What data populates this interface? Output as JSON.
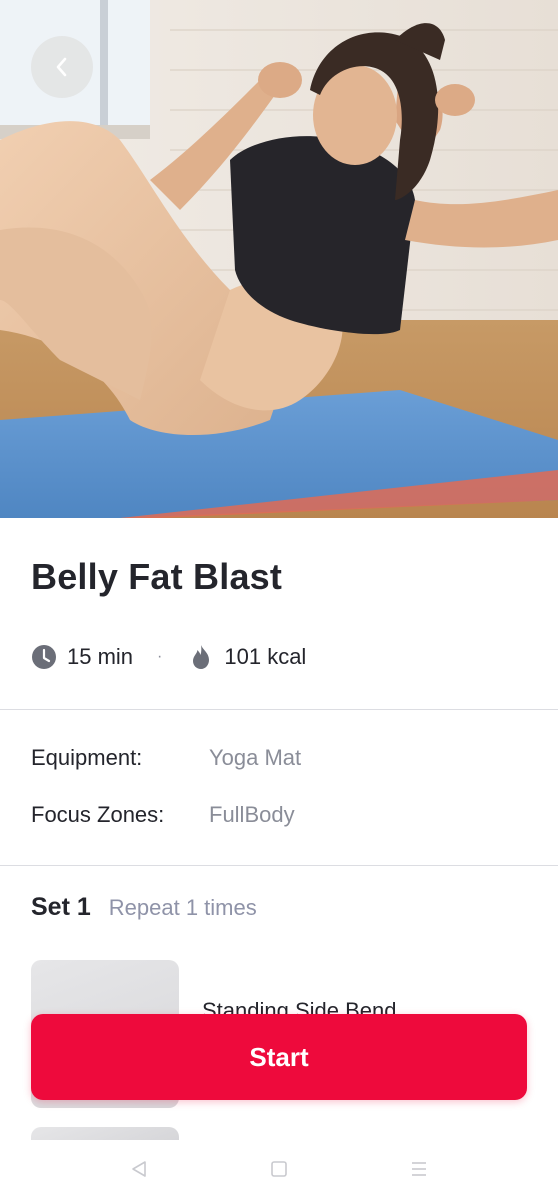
{
  "workout": {
    "title": "Belly Fat Blast",
    "duration": "15 min",
    "separator": "·",
    "calories": "101 kcal"
  },
  "details": {
    "equipment_label": "Equipment:",
    "equipment_value": "Yoga Mat",
    "focus_label": "Focus Zones:",
    "focus_value": "FullBody"
  },
  "set": {
    "title": "Set 1",
    "repeat": "Repeat 1 times",
    "exercises": [
      {
        "name": "Standing Side Bend"
      }
    ]
  },
  "actions": {
    "start_label": "Start"
  },
  "icons": {
    "back": "chevron-left-icon",
    "duration": "clock-icon",
    "calories": "flame-icon",
    "nav_back": "triangle-back-icon",
    "nav_home": "square-home-icon",
    "nav_menu": "menu-lines-icon"
  },
  "colors": {
    "accent": "#ee0a3c",
    "text_primary": "#24252c",
    "text_secondary": "#8a8d98",
    "divider": "#dcdde2"
  }
}
